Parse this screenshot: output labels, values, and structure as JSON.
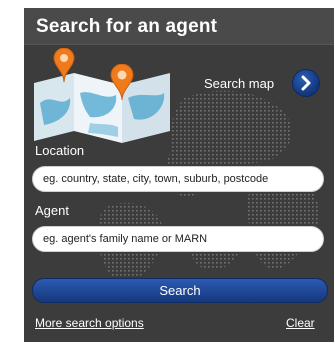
{
  "header": {
    "title": "Search for an agent"
  },
  "map": {
    "label": "Search map"
  },
  "location": {
    "label": "Location",
    "placeholder": "eg. country, state, city, town, suburb, postcode"
  },
  "agent": {
    "label": "Agent",
    "placeholder": "eg. agent's family name or MARN"
  },
  "buttons": {
    "search": "Search"
  },
  "links": {
    "more_options": "More search options",
    "clear": "Clear"
  },
  "colors": {
    "panel": "#3c3c3c",
    "header": "#4a4a4a",
    "accent_blue": "#1f4a9a",
    "pin_orange": "#f07b1d"
  }
}
